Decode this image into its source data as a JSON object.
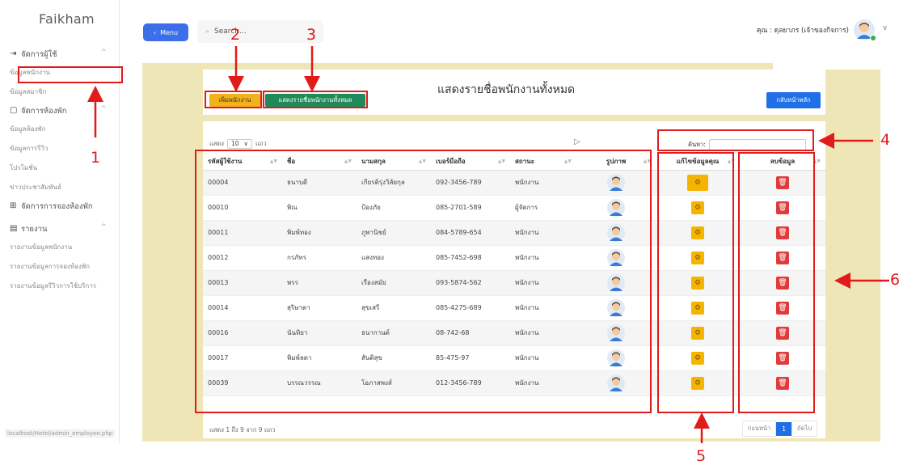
{
  "brand": "Faikham",
  "sidebar": {
    "groups": [
      {
        "label": "จัดการผู้ใช้",
        "items": [
          "ข้อมูลพนักงาน",
          "ข้อมูลสมาชิก"
        ]
      },
      {
        "label": "จัดการห้องพัก",
        "items": [
          "ข้อมูลห้องพัก",
          "ข้อมูลการรีวิว",
          "โปรโมชั่น",
          "ข่าวประชาสัมพันธ์"
        ]
      },
      {
        "label": "จัดการการจองห้องพัก",
        "items": []
      },
      {
        "label": "รายงาน",
        "items": [
          "รายงานข้อมูลพนักงาน",
          "รายงานข้อมูลการจองห้องพัก",
          "รายงานข้อมูลรีวิวการใช้บริการ"
        ]
      }
    ],
    "status_url": "localhost/Hotel/admin_employee.php"
  },
  "topbar": {
    "menu_label": "Menu",
    "search_value": "Search...",
    "user_text": "คุณ : ดุลยาภร (เจ้าของกิจการ)"
  },
  "page": {
    "title": "แสดงรายชื่อพนักงานทั้งหมด",
    "btn_add": "เพิ่มพนักงาน",
    "btn_all": "แสดงรายชื่อพนักงานทั้งหมด",
    "btn_home": "กลับหน้าหลัก"
  },
  "table": {
    "length_prefix": "แสดง",
    "length_value": "10",
    "length_suffix": "แถว",
    "search_label": "ค้นหา:",
    "headers": [
      "รหัสผู้ใช้งาน",
      "ชื่อ",
      "นามสกุล",
      "เบอร์มือถือ",
      "สถานะ",
      "รูปภาพ",
      "แก้ไขข้อมูลคุณ",
      "ลบข้อมูล"
    ],
    "rows": [
      {
        "id": "00004",
        "first": "ธนาบดี",
        "last": "เกียรติรุ่งวิลัยกุล",
        "phone": "092-3456-789",
        "status": "พนักงาน"
      },
      {
        "id": "00010",
        "first": "พิณ",
        "last": "ป้องภัย",
        "phone": "085-2701-589",
        "status": "ผู้จัดการ"
      },
      {
        "id": "00011",
        "first": "พิมพ์ทอง",
        "last": "ภูพานิชย์",
        "phone": "084-5789-654",
        "status": "พนักงาน"
      },
      {
        "id": "00012",
        "first": "กรภัทร",
        "last": "แสงทอง",
        "phone": "085-7452-698",
        "status": "พนักงาน"
      },
      {
        "id": "00013",
        "first": "พรร",
        "last": "เรืองสมัย",
        "phone": "093-5874-562",
        "status": "พนักงาน"
      },
      {
        "id": "00014",
        "first": "สุริษาดา",
        "last": "สุขเสรี",
        "phone": "085-4275-689",
        "status": "พนักงาน"
      },
      {
        "id": "00016",
        "first": "นันทิยา",
        "last": "ธนากานต์",
        "phone": "08-742-68",
        "status": "พนักงาน"
      },
      {
        "id": "00017",
        "first": "พิมพ์ลดา",
        "last": "สันติสุข",
        "phone": "85-475-97",
        "status": "พนักงาน"
      },
      {
        "id": "00039",
        "first": "บรรณวรรณ",
        "last": "โอภาสพงส์",
        "phone": "012-3456-789",
        "status": "พนักงาน"
      }
    ],
    "info": "แสดง 1 ถึง 9 จาก 9 แถว",
    "pager_prev": "ก่อนหน้า",
    "pager_current": "1",
    "pager_next": "ถัดไป"
  },
  "annotations": {
    "n1": "1",
    "n2": "2",
    "n3": "3",
    "n4": "4",
    "n5": "5",
    "n6": "6"
  },
  "colors": {
    "accent_blue": "#3b6ee8",
    "add_yellow": "#f2b21c",
    "list_green": "#1f8a5a",
    "home_blue": "#1f6fe6",
    "content_bg": "#efe6b8",
    "annotation_red": "#e11a1a"
  }
}
